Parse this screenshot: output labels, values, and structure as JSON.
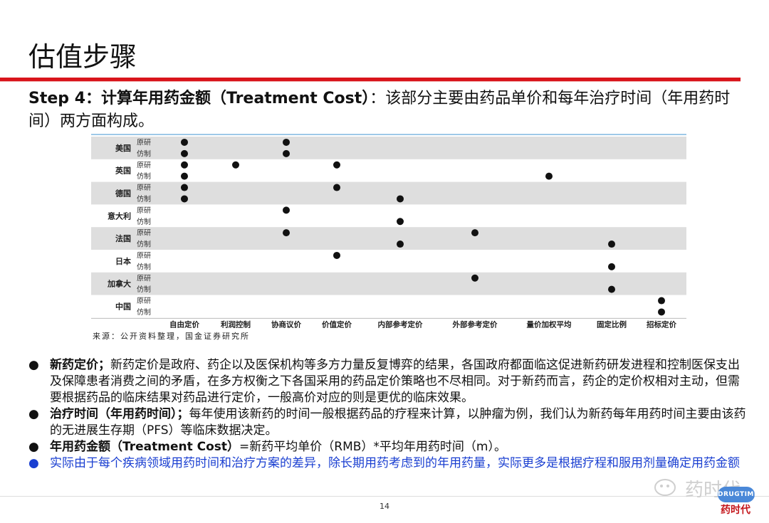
{
  "title": "估值步骤",
  "step": {
    "label": "Step 4：计算年用药金额（Treatment Cost）",
    "rest": "：该部分主要由药品单价和每年治疗时间（年用药时间）两方面构成。"
  },
  "chart_data": {
    "type": "scatter",
    "countries": [
      {
        "name": "美国",
        "rows": [
          {
            "label": "原研",
            "cols": [
              0,
              2
            ]
          },
          {
            "label": "仿制",
            "cols": [
              0,
              2
            ]
          }
        ]
      },
      {
        "name": "英国",
        "rows": [
          {
            "label": "原研",
            "cols": [
              0,
              1,
              3
            ]
          },
          {
            "label": "仿制",
            "cols": [
              0,
              6
            ]
          }
        ]
      },
      {
        "name": "德国",
        "rows": [
          {
            "label": "原研",
            "cols": [
              0,
              3
            ]
          },
          {
            "label": "仿制",
            "cols": [
              0,
              4
            ]
          }
        ]
      },
      {
        "name": "意大利",
        "rows": [
          {
            "label": "原研",
            "cols": [
              2
            ]
          },
          {
            "label": "仿制",
            "cols": [
              4
            ]
          }
        ]
      },
      {
        "name": "法国",
        "rows": [
          {
            "label": "原研",
            "cols": [
              2,
              5
            ]
          },
          {
            "label": "仿制",
            "cols": [
              4,
              7
            ]
          }
        ]
      },
      {
        "name": "日本",
        "rows": [
          {
            "label": "原研",
            "cols": [
              3
            ]
          },
          {
            "label": "仿制",
            "cols": [
              7
            ]
          }
        ]
      },
      {
        "name": "加拿大",
        "rows": [
          {
            "label": "原研",
            "cols": [
              5
            ]
          },
          {
            "label": "仿制",
            "cols": [
              7
            ]
          }
        ]
      },
      {
        "name": "中国",
        "rows": [
          {
            "label": "原研",
            "cols": [
              8
            ]
          },
          {
            "label": "仿制",
            "cols": [
              8
            ]
          }
        ]
      }
    ],
    "categories": [
      "自由定价",
      "利润控制",
      "协商议价",
      "价值定价",
      "内部参考定价",
      "外部参考定价",
      "量价加权平均",
      "固定比例",
      "招标定价"
    ],
    "grid": false
  },
  "source": "来源：公开资料整理，国金证券研究所",
  "bullets": [
    {
      "bold": "新药定价；",
      "text": "新药定价是政府、药企以及医保机构等多方力量反复博弈的结果，各国政府都面临这促进新药研发进程和控制医保支出及保障患者消费之间的矛盾，在多方权衡之下各国采用的药品定价策略也不尽相同。对于新药而言，药企的定价权相对主动，但需要根据药品的临床结果对药品进行定价，一般高价对应的则是更优的临床效果。",
      "color": "black"
    },
    {
      "bold": "治疗时间（年用药时间）；",
      "text": "每年使用该新药的时间一般根据药品的疗程来计算，以肿瘤为例，我们认为新药每年用药时间主要由该药的无进展生存期（PFS）等临床数据决定。",
      "color": "black"
    },
    {
      "bold": "年用药金额（Treatment Cost）",
      "text": "=新药平均单价（RMB）*平均年用药时间（m）。",
      "color": "black"
    },
    {
      "bold": "",
      "text": "实际由于每个疾病领域用药时间和治疗方案的差异，除长期用药考虑到的年用药量，实际更多是根据疗程和服用剂量确定用药金额",
      "color": "blue"
    }
  ],
  "bullet_glyph": "●",
  "page_number": "14",
  "watermark": "药时代",
  "logo": {
    "badge": "DRUGTIMES",
    "name": "药时代"
  }
}
